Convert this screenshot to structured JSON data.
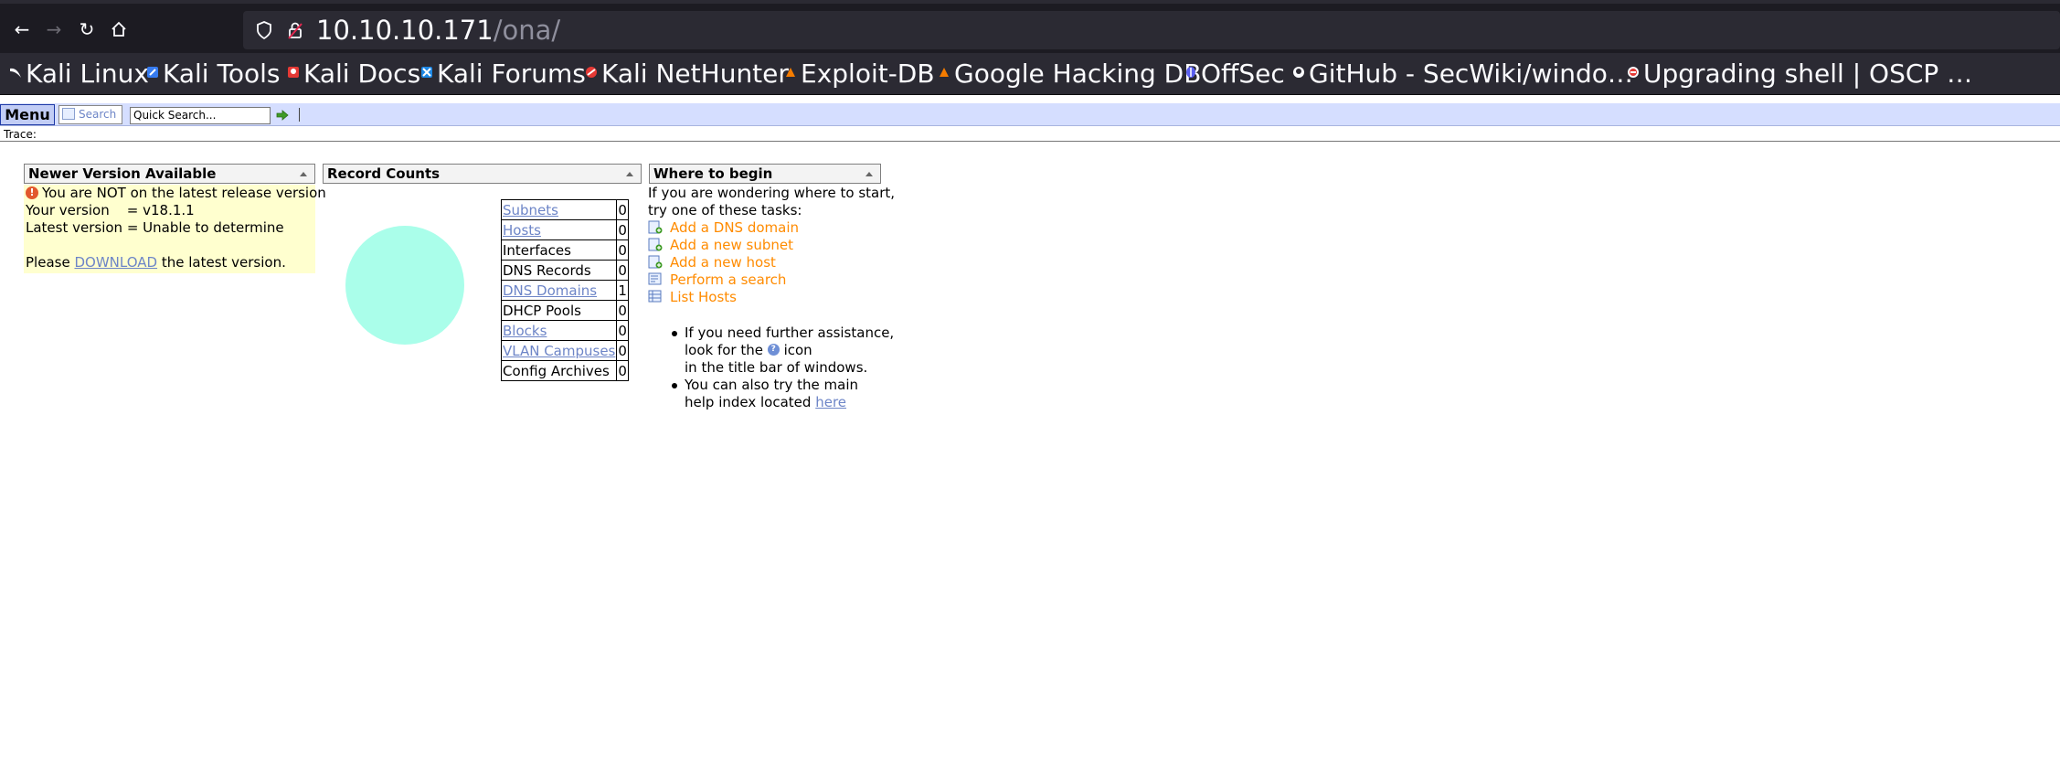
{
  "browser": {
    "url_host": "10.10.10.171",
    "url_path": "/ona/",
    "bookmarks": [
      {
        "label": "Kali Linux",
        "icon": "kali-dragon-icon"
      },
      {
        "label": "Kali Tools",
        "icon": "kali-tools-icon"
      },
      {
        "label": "Kali Docs",
        "icon": "kali-docs-icon"
      },
      {
        "label": "Kali Forums",
        "icon": "kali-forums-icon"
      },
      {
        "label": "Kali NetHunter",
        "icon": "nethunter-icon"
      },
      {
        "label": "Exploit-DB",
        "icon": "exploit-db-icon"
      },
      {
        "label": "Google Hacking DB",
        "icon": "ghdb-icon"
      },
      {
        "label": "OffSec",
        "icon": "offsec-icon"
      },
      {
        "label": "GitHub - SecWiki/windo…",
        "icon": "github-icon"
      },
      {
        "label": "Upgrading shell | OSCP …",
        "icon": "shell-icon"
      }
    ]
  },
  "menubar": {
    "menu_label": "Menu",
    "search_label": "Search",
    "quick_search_value": "Quick Search..."
  },
  "trace_label": "Trace:",
  "panels": {
    "newer_version": {
      "title": "Newer Version Available",
      "warning": "You are NOT on the latest release version",
      "your_version": "Your version    = v18.1.1",
      "latest_version": "Latest version = Unable to determine",
      "please": "Please",
      "download_link": "DOWNLOAD",
      "after_link": "the latest version."
    },
    "record_counts": {
      "title": "Record Counts",
      "rows": [
        {
          "label": "Subnets",
          "value": "0",
          "linked": true
        },
        {
          "label": "Hosts",
          "value": "0",
          "linked": true
        },
        {
          "label": "Interfaces",
          "value": "0",
          "linked": false
        },
        {
          "label": "DNS Records",
          "value": "0",
          "linked": false
        },
        {
          "label": "DNS Domains",
          "value": "1",
          "linked": true
        },
        {
          "label": "DHCP Pools",
          "value": "0",
          "linked": false
        },
        {
          "label": "Blocks",
          "value": "0",
          "linked": true
        },
        {
          "label": "VLAN Campuses",
          "value": "0",
          "linked": true
        },
        {
          "label": "Config Archives",
          "value": "0",
          "linked": false
        }
      ],
      "pie_color": "#aafeea"
    },
    "where_to_begin": {
      "title": "Where to begin",
      "intro_1": "If you are wondering where to start,",
      "intro_2": "try one of these tasks:",
      "tasks": [
        "Add a DNS domain",
        "Add a new subnet",
        "Add a new host",
        "Perform a search",
        "List Hosts"
      ],
      "help_1a": "If you need further assistance,",
      "help_1b_pre": "look for the",
      "help_1b_post": "icon",
      "help_1c": "in the title bar of windows.",
      "help_2a": "You can also try the main",
      "help_2b_pre": "help index located",
      "help_2b_link": "here"
    }
  },
  "colors": {
    "link": "#6d85c7",
    "task": "#ff8b00",
    "version_bg": "#ffffcf",
    "menubar_bg": "#d5deff"
  }
}
